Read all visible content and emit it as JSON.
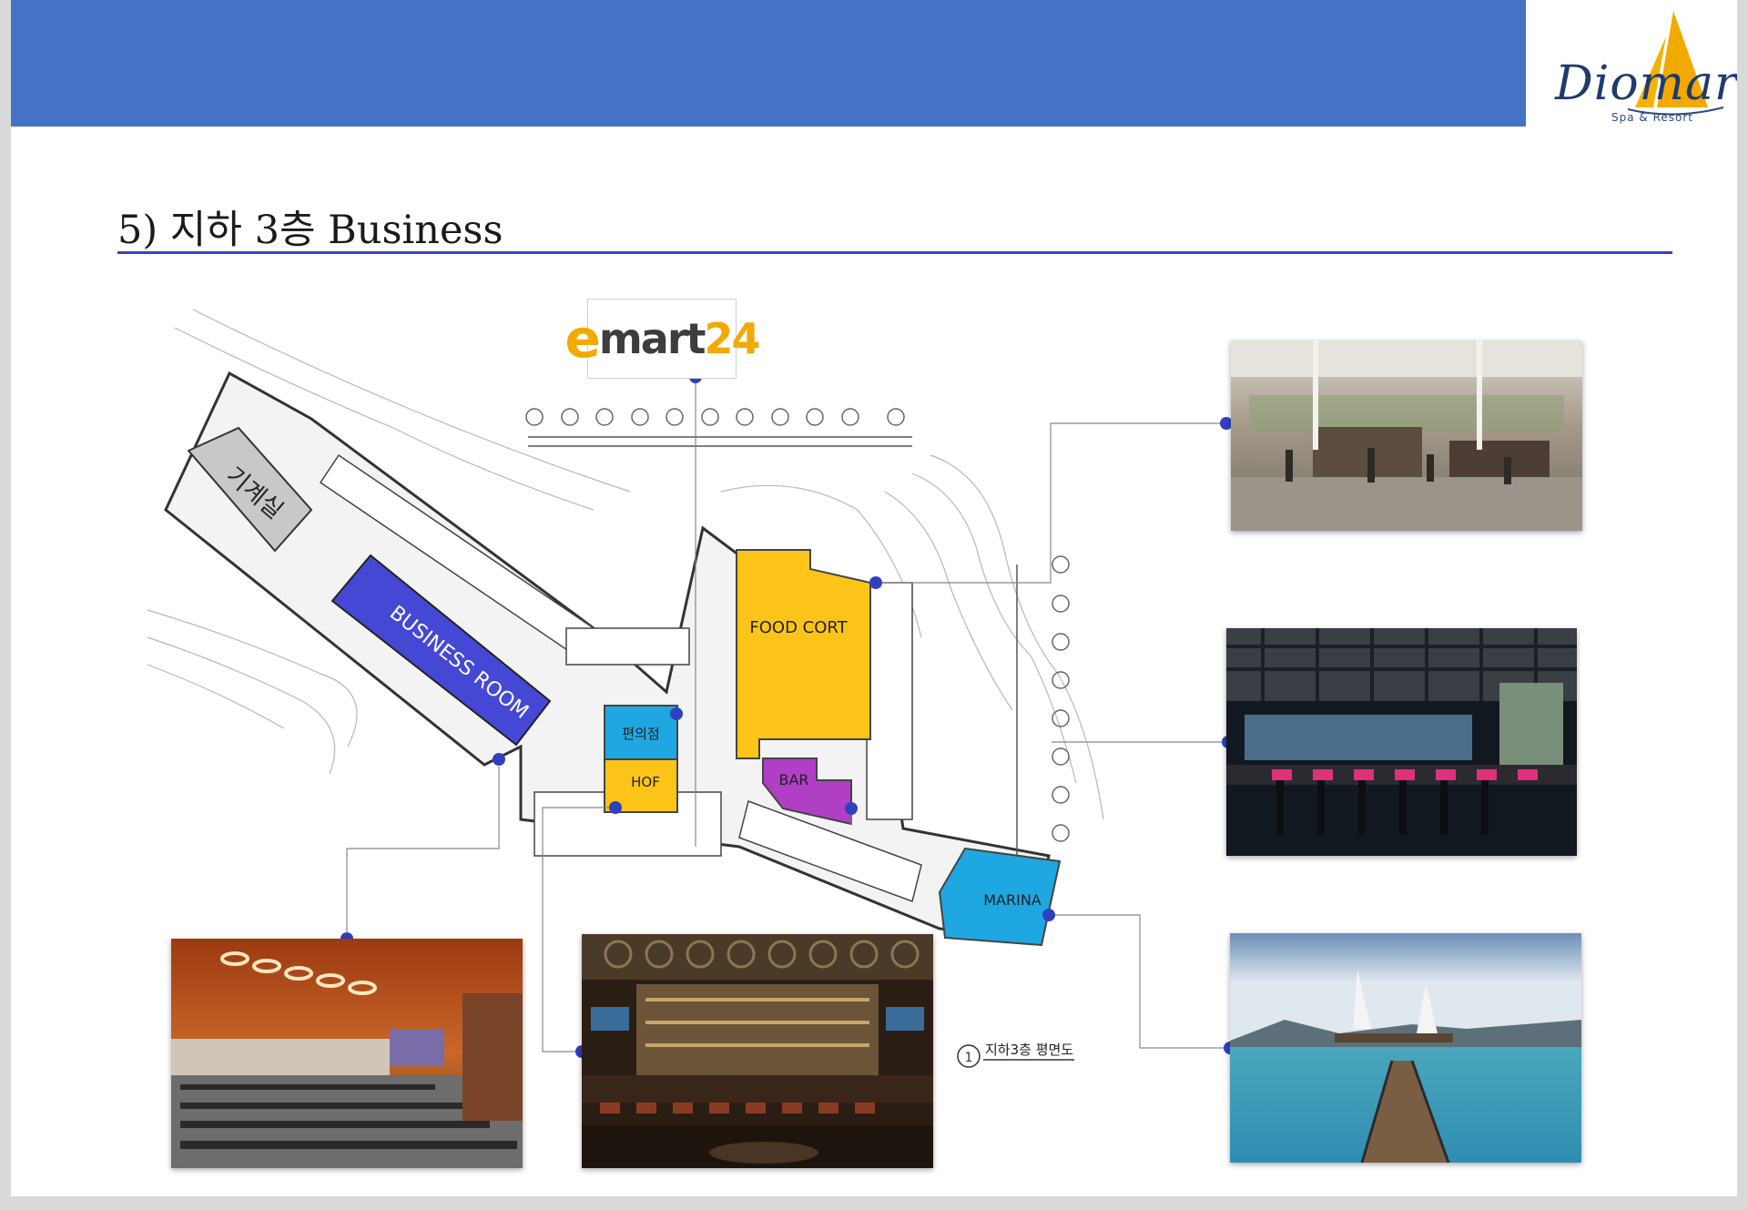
{
  "slide": {
    "title": "5) 지하 3층 Business"
  },
  "logo": {
    "name": "Diomare",
    "tagline": "Spa & Resort"
  },
  "emart": {
    "e": "e",
    "rest": "mart",
    "num": "24"
  },
  "floorplan": {
    "rooms": {
      "machine_room": "기계실",
      "business_room": "BUSINESS ROOM",
      "food_court": "FOOD CORT",
      "convenience_store": "편의점",
      "hof": "HOF",
      "bar": "BAR",
      "marina": "MARINA"
    },
    "plan_label_number": "1",
    "plan_label": "지하3층 평면도"
  },
  "photos": [
    {
      "name": "food-court-photo"
    },
    {
      "name": "bar-lounge-photo"
    },
    {
      "name": "marina-pier-photo"
    },
    {
      "name": "conference-hall-photo"
    },
    {
      "name": "hof-bar-photo"
    }
  ],
  "colors": {
    "header_band": "#4472c4",
    "title_rule": "#3a3fc9",
    "business_room": "#4548d4",
    "food_court": "#fcc419",
    "convenience_store": "#1ea7e1",
    "hof": "#fcc419",
    "bar": "#b03fc6",
    "marina": "#1ea7e1",
    "connector_dot": "#3040c0"
  }
}
